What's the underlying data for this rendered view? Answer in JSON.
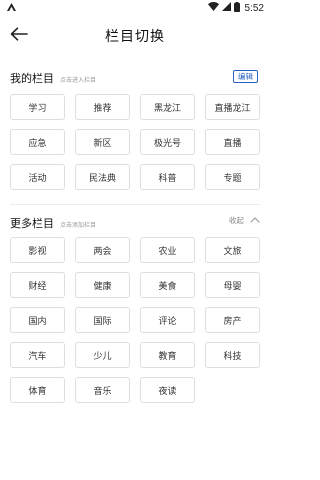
{
  "status_bar": {
    "time": "5:52",
    "icons": [
      "app-logo-icon",
      "wifi-icon",
      "signal-icon",
      "battery-icon"
    ]
  },
  "header": {
    "title": "栏目切换",
    "back_icon": "arrow-left-icon"
  },
  "my_channels": {
    "title": "我的栏目",
    "hint": "点击进入栏目",
    "edit_label": "编辑",
    "items": [
      "学习",
      "推荐",
      "黑龙江",
      "直播龙江",
      "应急",
      "新区",
      "极光号",
      "直播",
      "活动",
      "民法典",
      "科普",
      "专题"
    ]
  },
  "more_channels": {
    "title": "更多栏目",
    "hint": "点击添加栏目",
    "collapse_label": "收起",
    "items": [
      "影视",
      "两会",
      "农业",
      "文旅",
      "财经",
      "健康",
      "美食",
      "母婴",
      "国内",
      "国际",
      "评论",
      "房产",
      "汽车",
      "少儿",
      "教育",
      "科技",
      "体育",
      "音乐",
      "夜读"
    ]
  },
  "colors": {
    "accent": "#2962c4",
    "chip_border": "#dedede",
    "hint": "#999999"
  }
}
